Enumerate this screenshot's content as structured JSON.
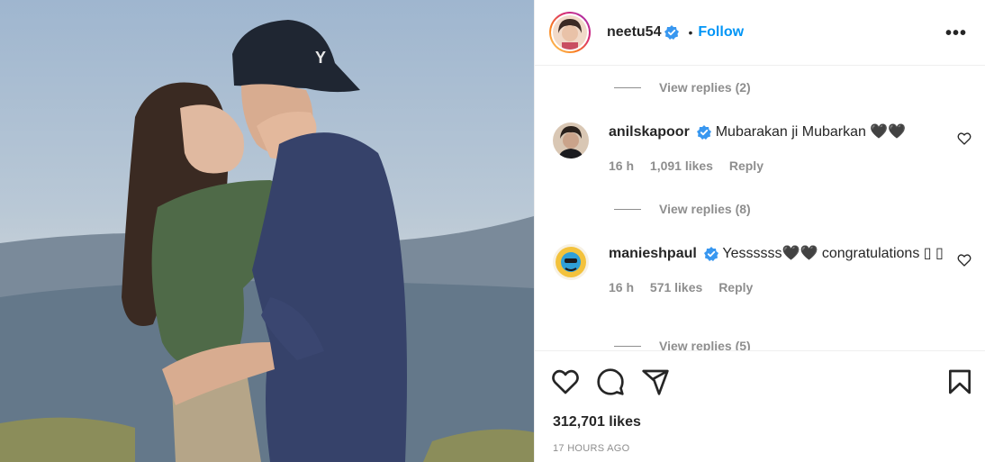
{
  "post": {
    "username": "neetu54",
    "dot": "•",
    "follow_label": "Follow",
    "more_label": "•••",
    "likes": "312,701 likes",
    "timestamp": "17 HOURS AGO"
  },
  "comments": [
    {
      "kind": "view_replies",
      "label": "View replies (2)"
    },
    {
      "kind": "comment",
      "username": "anilskapoor",
      "text": "Mubarakan ji Mubarkan 🖤🖤",
      "time": "16 h",
      "likes": "1,091 likes",
      "reply": "Reply"
    },
    {
      "kind": "view_replies",
      "label": "View replies (8)"
    },
    {
      "kind": "comment",
      "username": "manieshpaul",
      "text": "Yessssss🖤🖤 congratulations ▯ ▯",
      "time": "16 h",
      "likes": "571 likes",
      "reply": "Reply"
    },
    {
      "kind": "view_replies",
      "label": "View replies (5)"
    }
  ],
  "colors": {
    "accent": "#0095f6",
    "muted": "#8e8e8e",
    "verified": "#3897f0"
  },
  "icons": [
    "verified-badge-icon",
    "more-options-icon",
    "heart-icon",
    "comment-icon",
    "share-icon",
    "bookmark-icon"
  ]
}
